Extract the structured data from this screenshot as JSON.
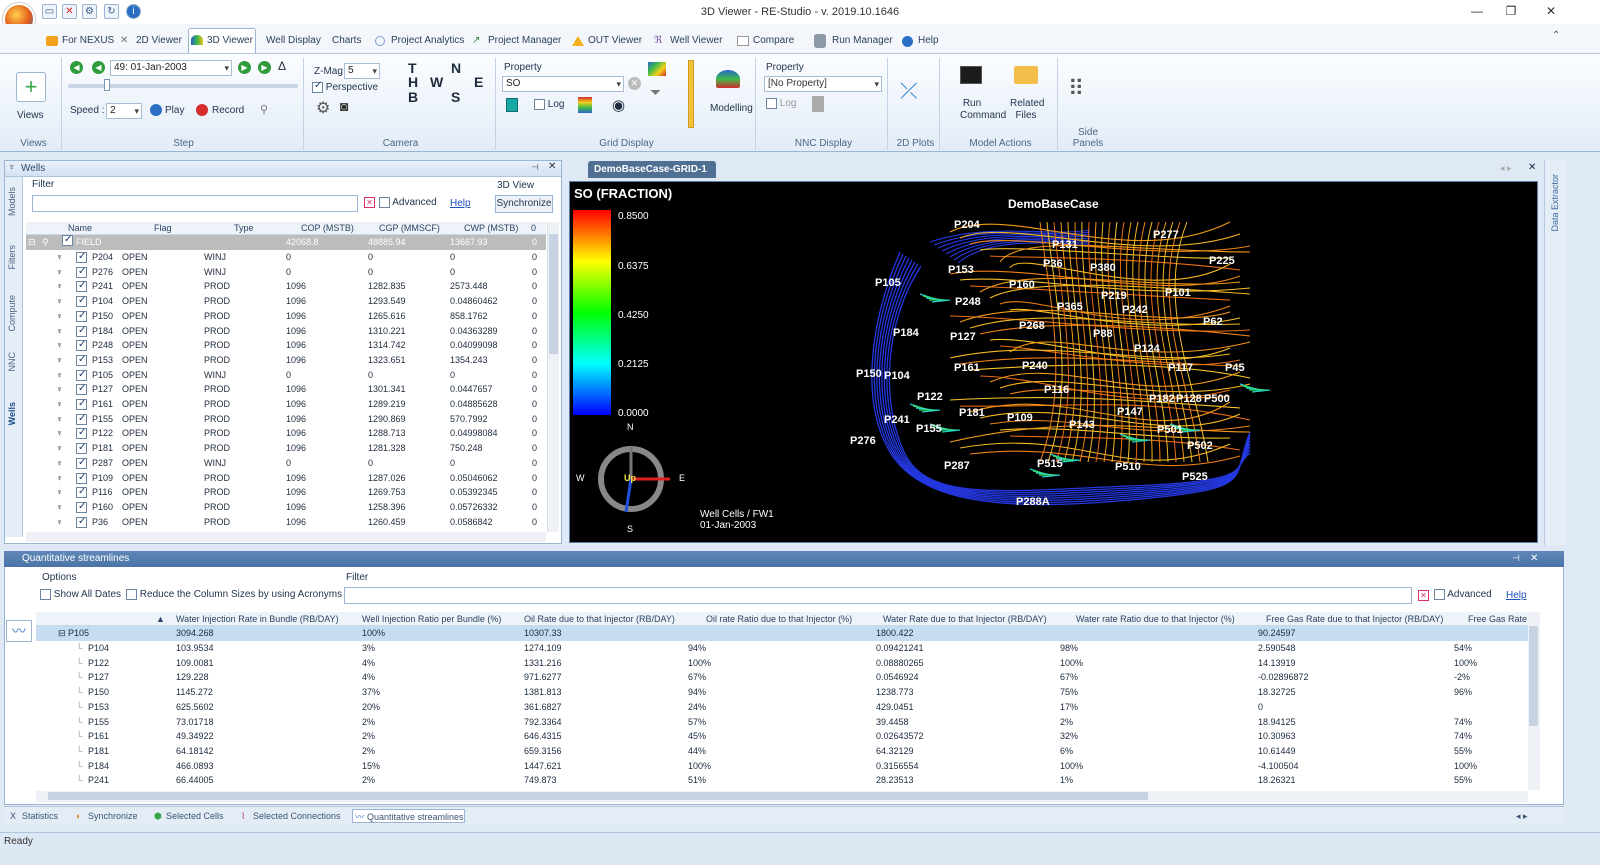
{
  "window": {
    "title": "3D Viewer - RE-Studio - v. 2019.10.1646"
  },
  "menu_tabs": [
    {
      "label": "For NEXUS"
    },
    {
      "label": "2D Viewer"
    },
    {
      "label": "3D Viewer"
    },
    {
      "label": "Well Display"
    },
    {
      "label": "Charts"
    },
    {
      "label": "Project Analytics"
    },
    {
      "label": "Project Manager"
    },
    {
      "label": "OUT Viewer"
    },
    {
      "label": "Well Viewer"
    },
    {
      "label": "Compare"
    },
    {
      "label": "Run Manager"
    },
    {
      "label": "Help"
    }
  ],
  "ribbon": {
    "views": {
      "button": "Views",
      "group": "Views"
    },
    "step": {
      "date": "49: 01-Jan-2003",
      "speed_label": "Speed :",
      "speed": "2",
      "play": "Play",
      "record": "Record",
      "group": "Step"
    },
    "camera": {
      "zmag_label": "Z-Mag",
      "zmag": "5",
      "perspective": "Perspective",
      "compass": [
        "T",
        "N",
        "H",
        "W",
        "E",
        "B",
        "S"
      ],
      "group": "Camera"
    },
    "grid_display": {
      "property_label": "Property",
      "property": "SO",
      "log": "Log",
      "modelling": "Modelling",
      "group": "Grid Display"
    },
    "nnc_display": {
      "property_label": "Property",
      "property": "[No Property]",
      "log": "Log",
      "group": "NNC Display"
    },
    "plots": {
      "group": "2D Plots"
    },
    "model_actions": {
      "run": "Run Command",
      "files": "Related Files",
      "group": "Model Actions"
    },
    "side_panels": {
      "group": "Side Panels"
    }
  },
  "wells_panel": {
    "title": "Wells",
    "filter_label": "Filter",
    "advanced": "Advanced",
    "help": "Help",
    "view3d_label": "3D View",
    "synchronize": "Synchronize",
    "columns": [
      "Name",
      "Flag",
      "Type",
      "COP (MSTB)",
      "CGP (MMSCF)",
      "CWP (MSTB)",
      "0"
    ],
    "field": {
      "name": "FIELD",
      "cop": "42068.8",
      "cgp": "48885.94",
      "cwp": "13667.93",
      "x": "0"
    },
    "rows": [
      {
        "name": "P204",
        "flag": "OPEN",
        "type": "WINJ",
        "cop": "0",
        "cgp": "0",
        "cwp": "0",
        "x": "0"
      },
      {
        "name": "P276",
        "flag": "OPEN",
        "type": "WINJ",
        "cop": "0",
        "cgp": "0",
        "cwp": "0",
        "x": "0"
      },
      {
        "name": "P241",
        "flag": "OPEN",
        "type": "PROD",
        "cop": "1096",
        "cgp": "1282.835",
        "cwp": "2573.448",
        "x": "0"
      },
      {
        "name": "P104",
        "flag": "OPEN",
        "type": "PROD",
        "cop": "1096",
        "cgp": "1293.549",
        "cwp": "0.04860462",
        "x": "0"
      },
      {
        "name": "P150",
        "flag": "OPEN",
        "type": "PROD",
        "cop": "1096",
        "cgp": "1265.616",
        "cwp": "858.1762",
        "x": "0"
      },
      {
        "name": "P184",
        "flag": "OPEN",
        "type": "PROD",
        "cop": "1096",
        "cgp": "1310.221",
        "cwp": "0.04363289",
        "x": "0"
      },
      {
        "name": "P248",
        "flag": "OPEN",
        "type": "PROD",
        "cop": "1096",
        "cgp": "1314.742",
        "cwp": "0.04099098",
        "x": "0"
      },
      {
        "name": "P153",
        "flag": "OPEN",
        "type": "PROD",
        "cop": "1096",
        "cgp": "1323.651",
        "cwp": "1354.243",
        "x": "0"
      },
      {
        "name": "P105",
        "flag": "OPEN",
        "type": "WINJ",
        "cop": "0",
        "cgp": "0",
        "cwp": "0",
        "x": "0"
      },
      {
        "name": "P127",
        "flag": "OPEN",
        "type": "PROD",
        "cop": "1096",
        "cgp": "1301.341",
        "cwp": "0.0447657",
        "x": "0"
      },
      {
        "name": "P161",
        "flag": "OPEN",
        "type": "PROD",
        "cop": "1096",
        "cgp": "1289.219",
        "cwp": "0.04885628",
        "x": "0"
      },
      {
        "name": "P155",
        "flag": "OPEN",
        "type": "PROD",
        "cop": "1096",
        "cgp": "1290.869",
        "cwp": "570.7992",
        "x": "0"
      },
      {
        "name": "P122",
        "flag": "OPEN",
        "type": "PROD",
        "cop": "1096",
        "cgp": "1288.713",
        "cwp": "0.04998084",
        "x": "0"
      },
      {
        "name": "P181",
        "flag": "OPEN",
        "type": "PROD",
        "cop": "1096",
        "cgp": "1281.328",
        "cwp": "750.248",
        "x": "0"
      },
      {
        "name": "P287",
        "flag": "OPEN",
        "type": "WINJ",
        "cop": "0",
        "cgp": "0",
        "cwp": "0",
        "x": "0"
      },
      {
        "name": "P109",
        "flag": "OPEN",
        "type": "PROD",
        "cop": "1096",
        "cgp": "1287.026",
        "cwp": "0.05046062",
        "x": "0"
      },
      {
        "name": "P116",
        "flag": "OPEN",
        "type": "PROD",
        "cop": "1096",
        "cgp": "1269.753",
        "cwp": "0.05392345",
        "x": "0"
      },
      {
        "name": "P160",
        "flag": "OPEN",
        "type": "PROD",
        "cop": "1096",
        "cgp": "1258.396",
        "cwp": "0.05726332",
        "x": "0"
      },
      {
        "name": "P36",
        "flag": "OPEN",
        "type": "PROD",
        "cop": "1096",
        "cgp": "1260.459",
        "cwp": "0.0586842",
        "x": "0"
      }
    ]
  },
  "side_tabs": [
    "Models",
    "Filters",
    "Compute",
    "NNC",
    "Wells"
  ],
  "right_tabs": [
    "Data Extractor"
  ],
  "viewer": {
    "tab": "DemoBaseCase-GRID-1",
    "legend_title": "SO (FRACTION)",
    "legend_values": [
      "0.8500",
      "0.6375",
      "0.4250",
      "0.2125",
      "0.0000"
    ],
    "model_name": "DemoBaseCase",
    "footer_line1": "Well Cells / FW1",
    "footer_line2": "01-Jan-2003",
    "compass": {
      "n": "N",
      "s": "S",
      "e": "E",
      "w": "W",
      "up": "Up"
    },
    "wells": [
      "P204",
      "P131",
      "P277",
      "P105",
      "P153",
      "P36",
      "P380",
      "P225",
      "P160",
      "P219",
      "P101",
      "P248",
      "P365",
      "P242",
      "P184",
      "P268",
      "P62",
      "P127",
      "P88",
      "P124",
      "P150",
      "P104",
      "P161",
      "P240",
      "P117",
      "P45",
      "P116",
      "P122",
      "P182",
      "P128",
      "P500",
      "P181",
      "P147",
      "P241",
      "P109",
      "P143",
      "P155",
      "P501",
      "P276",
      "P502",
      "P287",
      "P515",
      "P510",
      "P525",
      "P288A"
    ]
  },
  "streamlines_panel": {
    "title": "Quantitative streamlines",
    "options_label": "Options",
    "show_all_dates": "Show All Dates",
    "reduce_columns": "Reduce the Column Sizes by using Acronyms",
    "filter_label": "Filter",
    "advanced": "Advanced",
    "help": "Help",
    "columns": [
      "Water Injection Rate in Bundle (RB/DAY)",
      "Well Injection Ratio per Bundle (%)",
      "Oil Rate due to that Injector (RB/DAY)",
      "Oil rate Ratio due to that Injector (%)",
      "Water Rate due to that Injector (RB/DAY)",
      "Water rate Ratio due to that Injector (%)",
      "Free Gas Rate due to that Injector (RB/DAY)",
      "Free Gas Rate"
    ],
    "parent": {
      "name": "P105",
      "c1": "3094.268",
      "c2": "100%",
      "c3": "10307.33",
      "c4": "",
      "c5": "1800.422",
      "c6": "",
      "c7": "90.24597",
      "c8": ""
    },
    "rows": [
      {
        "name": "P104",
        "c1": "103.9534",
        "c2": "3%",
        "c3": "1274.109",
        "c4": "94%",
        "c5": "0.09421241",
        "c6": "98%",
        "c7": "2.590548",
        "c8": "54%"
      },
      {
        "name": "P122",
        "c1": "109.0081",
        "c2": "4%",
        "c3": "1331.216",
        "c4": "100%",
        "c5": "0.08880265",
        "c6": "100%",
        "c7": "14.13919",
        "c8": "100%"
      },
      {
        "name": "P127",
        "c1": "129.228",
        "c2": "4%",
        "c3": "971.6277",
        "c4": "67%",
        "c5": "0.0546924",
        "c6": "67%",
        "c7": "-0.02896872",
        "c8": "-2%"
      },
      {
        "name": "P150",
        "c1": "1145.272",
        "c2": "37%",
        "c3": "1381.813",
        "c4": "94%",
        "c5": "1238.773",
        "c6": "75%",
        "c7": "18.32725",
        "c8": "96%"
      },
      {
        "name": "P153",
        "c1": "625.5602",
        "c2": "20%",
        "c3": "361.6827",
        "c4": "24%",
        "c5": "429.0451",
        "c6": "17%",
        "c7": "0",
        "c8": ""
      },
      {
        "name": "P155",
        "c1": "73.01718",
        "c2": "2%",
        "c3": "792.3364",
        "c4": "57%",
        "c5": "39.4458",
        "c6": "2%",
        "c7": "18.94125",
        "c8": "74%"
      },
      {
        "name": "P161",
        "c1": "49.34922",
        "c2": "2%",
        "c3": "646.4315",
        "c4": "45%",
        "c5": "0.02643572",
        "c6": "32%",
        "c7": "10.30963",
        "c8": "74%"
      },
      {
        "name": "P181",
        "c1": "64.18142",
        "c2": "2%",
        "c3": "659.3156",
        "c4": "44%",
        "c5": "64.32129",
        "c6": "6%",
        "c7": "10.61449",
        "c8": "55%"
      },
      {
        "name": "P184",
        "c1": "466.0893",
        "c2": "15%",
        "c3": "1447.621",
        "c4": "100%",
        "c5": "0.3156554",
        "c6": "100%",
        "c7": "-4.100504",
        "c8": "100%"
      },
      {
        "name": "P241",
        "c1": "66.44005",
        "c2": "2%",
        "c3": "749.873",
        "c4": "51%",
        "c5": "28.23513",
        "c6": "1%",
        "c7": "18.26321",
        "c8": "55%"
      }
    ]
  },
  "bottom_tabs": [
    "Statistics",
    "Synchronize",
    "Selected Cells",
    "Selected Connections",
    "Quantitative streamlines"
  ],
  "status": "Ready"
}
